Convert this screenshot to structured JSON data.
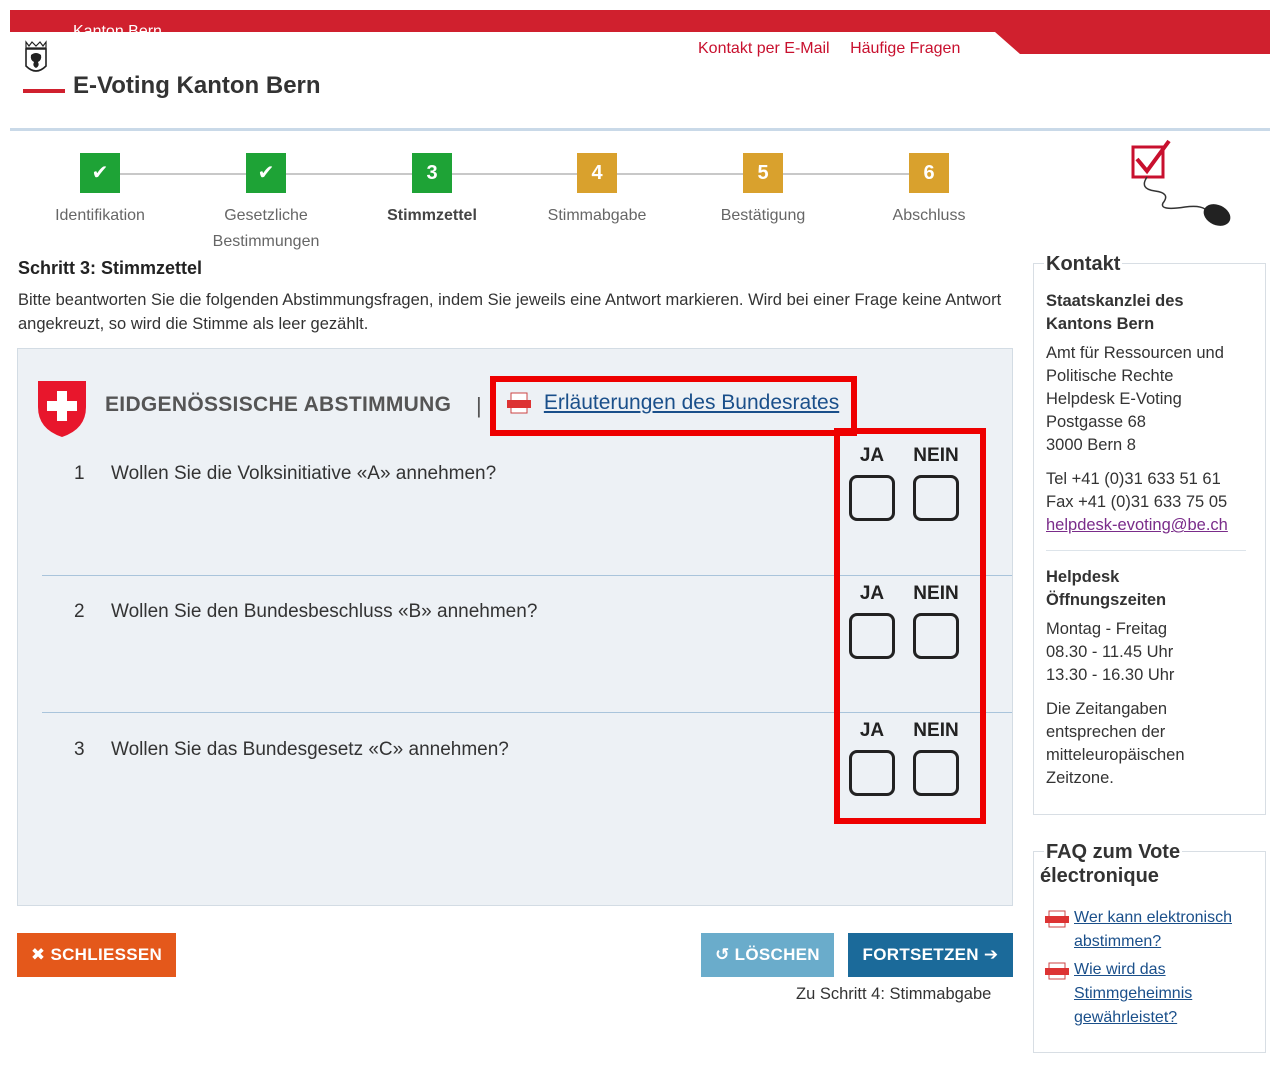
{
  "header": {
    "canton_label": "Kanton Bern",
    "site_title": "E-Voting Kanton Bern",
    "links": [
      "Kontakt per E-Mail",
      "Häufige Fragen"
    ]
  },
  "stepper": {
    "steps": [
      {
        "badge": "✔",
        "label": "Identifikation",
        "state": "done"
      },
      {
        "badge": "✔",
        "label": "Gesetzliche Bestimmungen",
        "state": "done"
      },
      {
        "badge": "3",
        "label": "Stimmzettel",
        "state": "current"
      },
      {
        "badge": "4",
        "label": "Stimmabgabe",
        "state": "todo"
      },
      {
        "badge": "5",
        "label": "Bestätigung",
        "state": "todo"
      },
      {
        "badge": "6",
        "label": "Abschluss",
        "state": "todo"
      }
    ]
  },
  "main": {
    "step_heading": "Schritt 3: Stimmzettel",
    "intro": "Bitte beantworten Sie die folgenden Abstimmungsfragen, indem Sie jeweils eine Antwort markieren. Wird bei einer Frage keine Antwort angekreuzt, so wird die Stimme als leer gezählt.",
    "ballot_title": "EIDGENÖSSISCHE ABSTIMMUNG",
    "separator": "|",
    "explanation_link": "Erläuterungen des Bundesrates",
    "answer_yes": "JA",
    "answer_no": "NEIN",
    "questions": [
      {
        "num": "1",
        "text": "Wollen Sie die Volksinitiative «A» annehmen?"
      },
      {
        "num": "2",
        "text": "Wollen Sie den Bundesbeschluss «B» annehmen?"
      },
      {
        "num": "3",
        "text": "Wollen Sie das Bundesgesetz «C» annehmen?"
      }
    ]
  },
  "buttons": {
    "close": "SCHLIESSEN",
    "clear": "LÖSCHEN",
    "next": "FORTSETZEN",
    "next_hint": "Zu Schritt 4: Stimmabgabe"
  },
  "sidebar": {
    "contact_title": "Kontakt",
    "org_line1": "Staatskanzlei des",
    "org_line2": "Kantons Bern",
    "addr": [
      "Amt für Ressourcen und",
      "Politische Rechte",
      "Helpdesk E-Voting",
      "Postgasse 68",
      "3000 Bern 8"
    ],
    "tel": "Tel +41 (0)31 633 51 61",
    "fax": "Fax +41 (0)31 633 75 05",
    "email": "helpdesk-evoting@be.ch",
    "hours_title1": "Helpdesk",
    "hours_title2": "Öffnungszeiten",
    "hours": [
      "Montag - Freitag",
      "08.30 - 11.45 Uhr",
      "13.30 - 16.30 Uhr"
    ],
    "tz_note": [
      "Die Zeitangaben",
      "entsprechen der",
      "mitteleuropäischen",
      "Zeitzone."
    ],
    "faq_title1": "FAQ zum Vote",
    "faq_title2": "électronique",
    "faq_items": [
      {
        "lines": [
          "Wer kann elektronisch",
          "abstimmen?"
        ]
      },
      {
        "lines": [
          "Wie wird das",
          "Stimmgeheimnis",
          "gewährleistet?"
        ]
      }
    ]
  },
  "colors": {
    "brand_red": "#d0202e",
    "step_done": "#1ea336",
    "step_todo": "#d9a12d",
    "btn_close": "#e4581b",
    "btn_clear": "#6aaccb",
    "btn_next": "#1b6a9a",
    "highlight": "#ee0000"
  }
}
